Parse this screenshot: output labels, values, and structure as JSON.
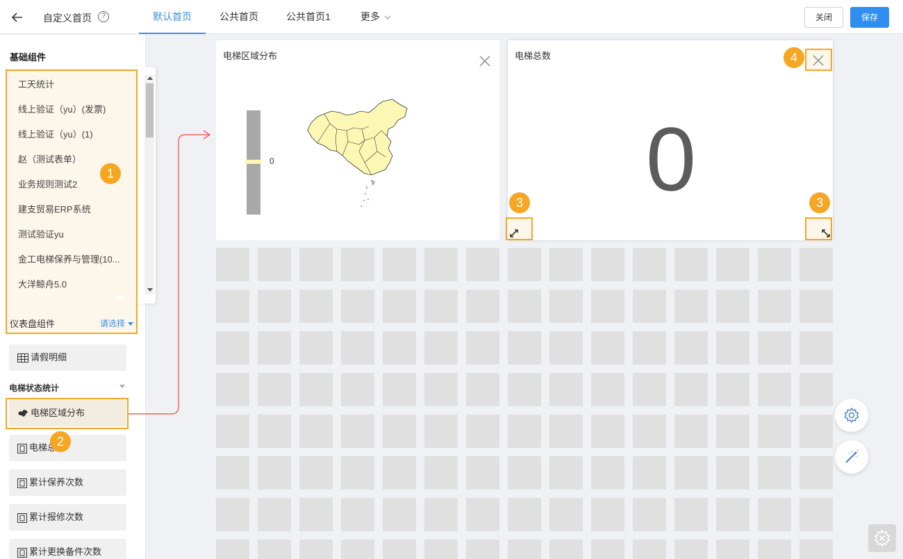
{
  "header": {
    "title": "自定义首页",
    "help_icon": "?",
    "tabs": [
      {
        "label": "默认首页",
        "active": true
      },
      {
        "label": "公共首页",
        "active": false
      },
      {
        "label": "公共首页1",
        "active": false
      },
      {
        "label": "更多",
        "active": false
      }
    ],
    "close_label": "关闭",
    "save_label": "保存"
  },
  "sidebar": {
    "section_title": "基础组件",
    "dropdown_items": [
      "工天统计",
      "线上验证（yu）(发票)",
      "线上验证（yu）(1)",
      "赵（测试表单）",
      "业务规则测试2",
      "建支贸易ERP系统",
      "测试验证yu",
      "金工电梯保养与管理(10...",
      "大洋鲸舟5.0"
    ],
    "dashboard_label": "仪表盘组件",
    "dashboard_select": "请选择",
    "leave_detail": "请假明细",
    "group_title": "电梯状态统计",
    "components": [
      "电梯区域分布",
      "电梯总数",
      "累计保养次数",
      "累计报修次数",
      "累计更换备件次数"
    ]
  },
  "cards": {
    "region": {
      "title": "电梯区域分布",
      "legend_value": "0"
    },
    "total": {
      "title": "电梯总数",
      "value": "0"
    }
  },
  "badges": {
    "b1": "1",
    "b2": "2",
    "b3": "3",
    "b4": "4"
  },
  "colors": {
    "accent": "#2f8ff0",
    "highlight": "#f5a623",
    "map_fill": "#fdf7b4"
  }
}
